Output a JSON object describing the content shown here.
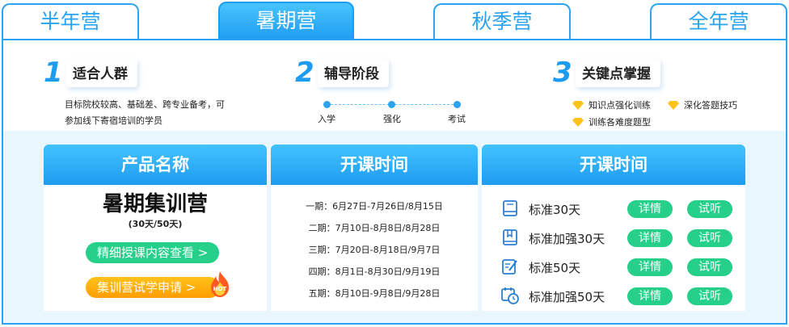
{
  "tabs": [
    {
      "label": "半年营",
      "active": false
    },
    {
      "label": "暑期营",
      "active": true
    },
    {
      "label": "秋季营",
      "active": false
    },
    {
      "label": "全年营",
      "active": false
    }
  ],
  "features": {
    "audience": {
      "num": "1",
      "title": "适合人群",
      "text": "目标院校较高、基础差、跨专业备考，可参加线下寄宿培训的学员"
    },
    "stages": {
      "num": "2",
      "title": "辅导阶段",
      "items": [
        "入学",
        "强化",
        "考试"
      ]
    },
    "keypoints": {
      "num": "3",
      "title": "关键点掌握",
      "items": [
        "知识点强化训练",
        "深化答题技巧",
        "训练各难度题型"
      ]
    }
  },
  "product": {
    "header": "产品名称",
    "name": "暑期集训营",
    "sub": "(30天/50天)",
    "content_button": "精细授课内容查看 >",
    "trial_button": "集训营试学申请 >",
    "hot_badge": "HOT"
  },
  "schedule": {
    "header": "开课时间",
    "sessions": [
      "一期：6月27日-7月26日/8月15日",
      "二期：7月10日-8月8日/8月28日",
      "三期：7月20日-8月18日/9月7日",
      "四期：8月1日-8月30日/9月19日",
      "五期：8月10日-9月8日/9月28日"
    ]
  },
  "courses": {
    "header": "开课时间",
    "detail_label": "详情",
    "trial_label": "试听",
    "items": [
      {
        "name": "标准30天",
        "icon": "book-icon"
      },
      {
        "name": "标准加强30天",
        "icon": "bookmark-book-icon"
      },
      {
        "name": "标准50天",
        "icon": "edit-note-icon"
      },
      {
        "name": "标准加强50天",
        "icon": "calendar-clock-icon"
      }
    ]
  },
  "colors": {
    "accent": "#1e9cf0",
    "green": "#26d08a",
    "orange": "#ffa800",
    "band": "#e9f6fe"
  }
}
